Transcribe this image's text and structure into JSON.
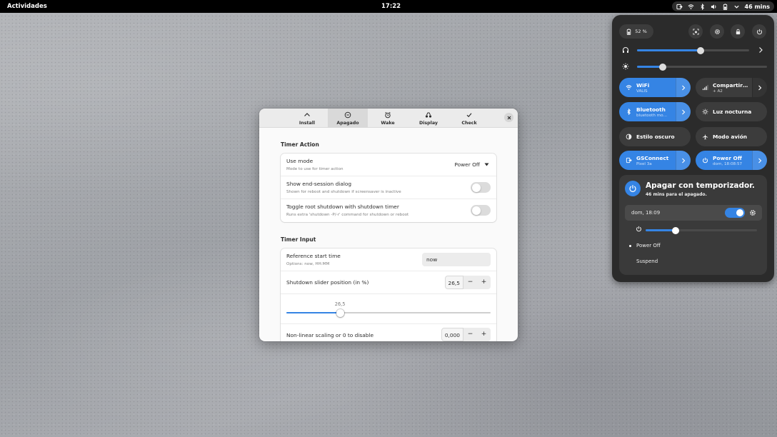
{
  "topbar": {
    "activities": "Actividades",
    "clock": "17:22",
    "battery_label": "46 mins",
    "indicators": [
      "screen-share-icon",
      "wifi-icon",
      "bluetooth-icon",
      "volume-icon",
      "battery-icon",
      "chevron-down-icon"
    ]
  },
  "app": {
    "tabs": [
      {
        "label": "Install",
        "icon": "chevron-up-icon"
      },
      {
        "label": "Apagado",
        "icon": "clock-icon",
        "active": true
      },
      {
        "label": "Wake",
        "icon": "alarm-icon"
      },
      {
        "label": "Display",
        "icon": "display-icon"
      },
      {
        "label": "Check",
        "icon": "check-icon"
      }
    ],
    "timer_action": {
      "title": "Timer Action",
      "use_mode": {
        "title": "Use mode",
        "subtitle": "Mode to use for timer action",
        "value": "Power Off"
      },
      "end_session": {
        "title": "Show end-session dialog",
        "subtitle": "Shown for reboot and shutdown if screensaver is inactive",
        "enabled": false
      },
      "root_shutdown": {
        "title": "Toggle root shutdown with shutdown timer",
        "subtitle": "Runs extra 'shutdown -P/-r' command for shutdown or reboot",
        "enabled": false
      }
    },
    "timer_input": {
      "title": "Timer Input",
      "reference_start": {
        "title": "Reference start time",
        "subtitle": "Options: now, HH:MM",
        "value": "now"
      },
      "slider_position": {
        "title": "Shutdown slider position (in %)",
        "value": "26,5",
        "slider_fraction": 0.265,
        "slider_label": "26,5"
      },
      "nonlinear": {
        "title": "Non-linear scaling or 0 to disable",
        "value": "0,000"
      },
      "minus": "−",
      "plus": "+"
    }
  },
  "quick_settings": {
    "battery": "52 %",
    "volume_fraction": 0.57,
    "brightness_fraction": 0.2,
    "tiles": [
      {
        "title": "WiFi",
        "subtitle": "VALIS",
        "on": true,
        "arrow": true,
        "icon": "wifi-icon"
      },
      {
        "title": "Compartir…",
        "subtitle": "+ A2",
        "on": false,
        "arrow": true,
        "icon": "signal-icon"
      },
      {
        "title": "Bluetooth",
        "subtitle": "bluetooth mo…",
        "on": true,
        "arrow": true,
        "icon": "bluetooth-icon"
      },
      {
        "title": "Luz nocturna",
        "subtitle": "",
        "on": false,
        "arrow": false,
        "icon": "night-light-icon"
      },
      {
        "title": "Estilo oscuro",
        "subtitle": "",
        "on": false,
        "arrow": false,
        "icon": "dark-style-icon"
      },
      {
        "title": "Modo avión",
        "subtitle": "",
        "on": false,
        "arrow": false,
        "icon": "airplane-icon"
      },
      {
        "title": "GSConnect",
        "subtitle": "Pixel 3a",
        "on": false,
        "arrow": true,
        "icon": "gsconnect-icon"
      },
      {
        "title": "Power Off",
        "subtitle": "dom, 18:08:57",
        "on": true,
        "arrow": true,
        "icon": "power-icon"
      }
    ],
    "timer": {
      "title": "Apagar con temporizador.",
      "subtitle": "46 mins para el apagado.",
      "schedule": "dom, 18:09",
      "schedule_enabled": true,
      "slider_fraction": 0.27,
      "options": [
        {
          "label": "Power Off",
          "selected": true
        },
        {
          "label": "Suspend",
          "selected": false
        }
      ]
    }
  }
}
